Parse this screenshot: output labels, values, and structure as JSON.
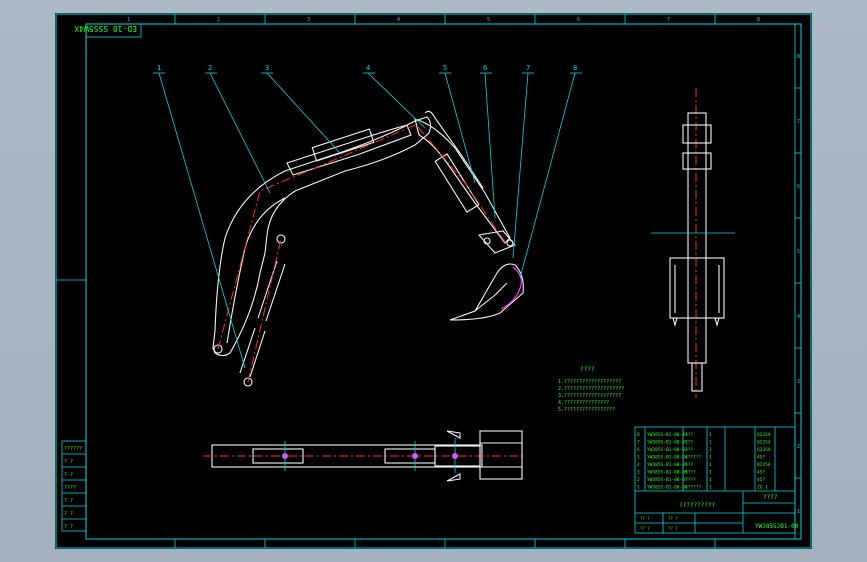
{
  "drawing": {
    "stamp_text": "ED-10 SSS5W4X",
    "balloon_labels": [
      "1",
      "2",
      "3",
      "4",
      "5",
      "6",
      "7",
      "8"
    ],
    "border_zone_labels_top": [
      "1",
      "2",
      "3",
      "4",
      "5",
      "6",
      "7",
      "8"
    ],
    "border_zone_labels_right": [
      "8",
      "7",
      "6",
      "5",
      "4",
      "3",
      "2",
      "1"
    ],
    "notes_title": "????",
    "notes_lines": [
      "1.???????????????????",
      "2.????????????????????",
      "3.???????????????????",
      "4.???????????????",
      "5.?????????????????"
    ],
    "left_strip_labels": [
      "??????",
      "? ?",
      "? ?",
      "????",
      "? ?",
      "? ?",
      "? ?"
    ],
    "bom_rows": [
      [
        "8",
        "YW385S-B1-00-01",
        "???",
        "1",
        "",
        "Q235A"
      ],
      [
        "7",
        "YW385S-B1-00-02",
        "???",
        "1",
        "",
        "Q235A"
      ],
      [
        "6",
        "YW385S-B1-00-03",
        "???",
        "1",
        "",
        "Q235A"
      ],
      [
        "5",
        "YW385S-B1-00-04",
        "??????",
        "1",
        "",
        "45?"
      ],
      [
        "4",
        "YW385S-B1-00-05",
        "???",
        "1",
        "",
        "Q235A"
      ],
      [
        "3",
        "YW385S-B1-00-06",
        "????",
        "1",
        "",
        "45?"
      ],
      [
        "2",
        "YW385S-B1-00-07",
        "????",
        "1",
        "",
        "45?"
      ],
      [
        "1",
        "YW385S-B1-00-08",
        "??????",
        "1",
        "",
        "ZG 1"
      ]
    ],
    "bom_header": [
      "?",
      "?",
      "?",
      "?",
      "?",
      "?",
      "?"
    ],
    "title_main": "??????????",
    "title_sub": "????",
    "drawing_number": "YW385SJB1-00",
    "small_labels": [
      "?? ?",
      "?? ?",
      "?? ?",
      "?? ?"
    ]
  },
  "colors": {
    "background": "#000000",
    "border": "#00d6e0",
    "outline": "#f4f4f4",
    "centerline": "#ff2a2a",
    "text": "#23ff23",
    "bucket_edge": "#ff3cff"
  }
}
